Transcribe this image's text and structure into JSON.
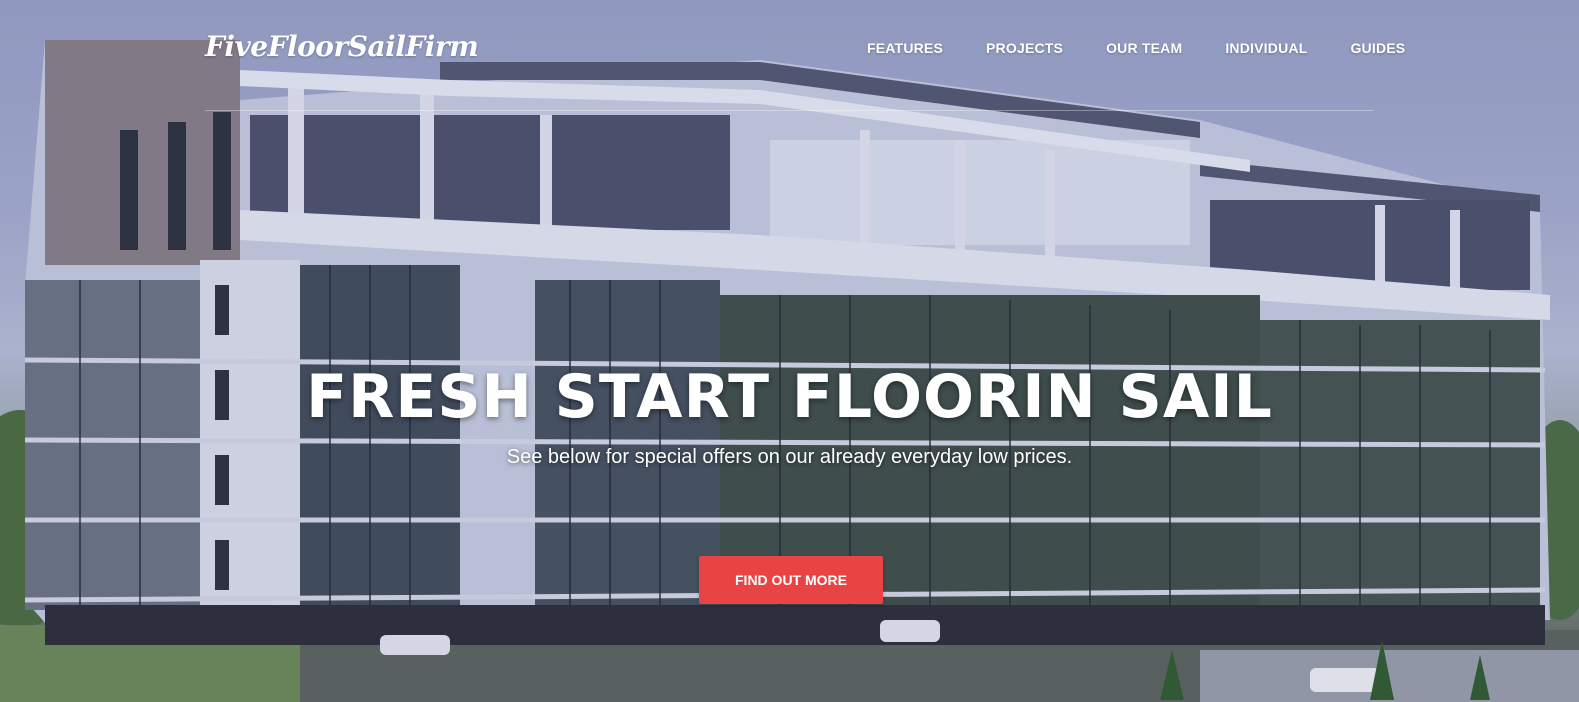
{
  "header": {
    "logo_text": "FiveFloorSailFirm",
    "nav": [
      {
        "label": "FEATURES"
      },
      {
        "label": "PROJECTS"
      },
      {
        "label": "OUR TEAM"
      },
      {
        "label": "INDIVIDUAL"
      },
      {
        "label": "GUIDES"
      }
    ]
  },
  "hero": {
    "title": "FRESH START FLOORIN SAIL",
    "subtitle": "See below for special offers on our already everyday low prices.",
    "cta_label": "FIND OUT MORE",
    "background_image": "modern-apartment-building-photo"
  },
  "colors": {
    "accent": "#e84444",
    "text": "#ffffff",
    "sky_tint": "#9aa2c6"
  }
}
